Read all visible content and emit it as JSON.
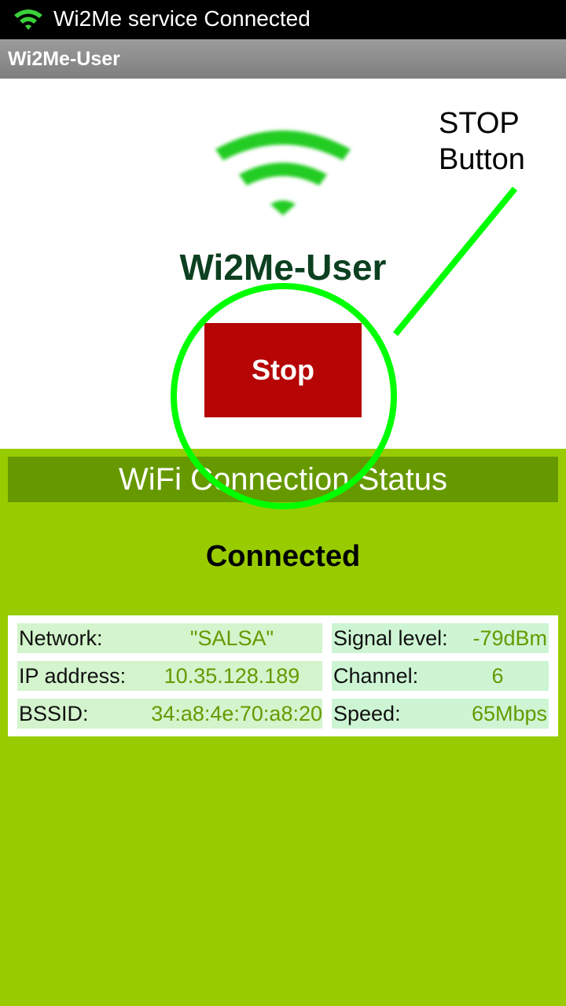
{
  "status_bar": {
    "notification_text": "Wi2Me service Connected",
    "icon": "wifi-icon"
  },
  "action_bar": {
    "title": "Wi2Me-User"
  },
  "main": {
    "icon": "wifi-icon",
    "app_name": "Wi2Me-User",
    "stop_label": "Stop"
  },
  "annotation": {
    "callout_text": "STOP\nButton",
    "color": "#00ff00"
  },
  "status_panel": {
    "header": "WiFi Connection Status",
    "state": "Connected",
    "rows": [
      {
        "left_label": "Network:",
        "left_value": "\"SALSA\"",
        "right_label": "Signal level:",
        "right_value": "-79dBm"
      },
      {
        "left_label": "IP address:",
        "left_value": "10.35.128.189",
        "right_label": "Channel:",
        "right_value": "6"
      },
      {
        "left_label": "BSSID:",
        "left_value": "34:a8:4e:70:a8:20",
        "right_label": "Speed:",
        "right_value": "65Mbps"
      }
    ]
  },
  "colors": {
    "stop_button": "#b50505",
    "panel_green": "#99cc00",
    "header_green": "#669900",
    "app_name": "#0c4020",
    "wifi_icon": "#22cc22"
  }
}
